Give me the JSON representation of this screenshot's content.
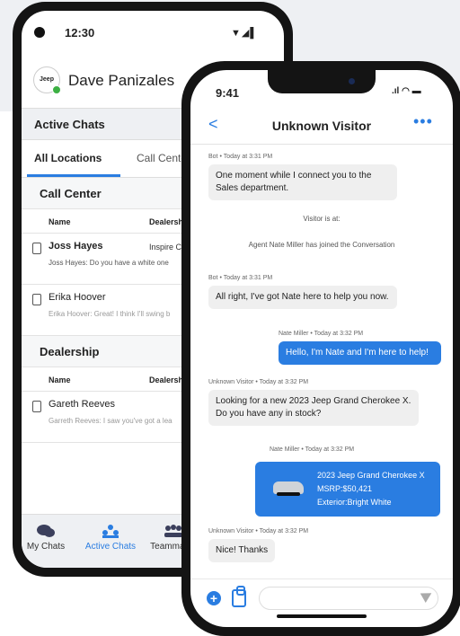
{
  "android": {
    "time": "12:30",
    "status_icons": "▼◢▌",
    "logo_text": "Jeep",
    "user_name": "Dave Panizales",
    "section_title": "Active Chats",
    "tabs": [
      "All Locations",
      "Call Center"
    ],
    "call_center": {
      "title": "Call Center",
      "col_name": "Name",
      "col_dealership": "Dealership",
      "rows": [
        {
          "name": "Joss Hayes",
          "dealership": "Inspire CDJR",
          "preview": "Joss Hayes: Do you have a white one"
        },
        {
          "name": "Erika Hoover",
          "dealership": "",
          "preview": "Erika Hoover: Great! I think I'll swing b"
        }
      ]
    },
    "dealership": {
      "title": "Dealership",
      "col_name": "Name",
      "col_dealership": "Dealership",
      "rows": [
        {
          "name": "Gareth Reeves",
          "dealership": "",
          "preview": "Garreth Reeves: I saw you've got a lea"
        }
      ]
    },
    "nav": [
      "My Chats",
      "Active Chats",
      "Teammates"
    ]
  },
  "iphone": {
    "time": "9:41",
    "status_icons": ".ıl ◠ ▬",
    "title": "Unknown Visitor",
    "back": "<",
    "more": "•••",
    "messages": {
      "m1_meta": "Bot • Today at 3:31 PM",
      "m1_text": "One moment while I connect you to the Sales department.",
      "sys1": "Visitor is at:",
      "sys2": "Agent Nate Miller has joined the Conversation",
      "m2_meta": "Bot • Today at 3:31 PM",
      "m2_text": "All right, I've got Nate here to help you now.",
      "m3_meta": "Nate Miller • Today at 3:32 PM",
      "m3_text": "Hello, I'm Nate and I'm here to help!",
      "m4_meta": "Unknown Visitor • Today at 3:32 PM",
      "m4_text": "Looking for a new 2023 Jeep Grand Cherokee X. Do you have any in stock?",
      "m5_meta": "Nate Miller • Today at 3:32 PM",
      "card_title": "2023 Jeep Grand Cherokee X",
      "card_msrp": "MSRP:$50,421",
      "card_ext": "Exterior:Bright White",
      "m6_meta": "Unknown Visitor • Today at 3:32 PM",
      "m6_text": "Nice! Thanks"
    },
    "input_placeholder": ""
  },
  "colors": {
    "accent": "#2a7de1",
    "online": "#3cb043"
  }
}
